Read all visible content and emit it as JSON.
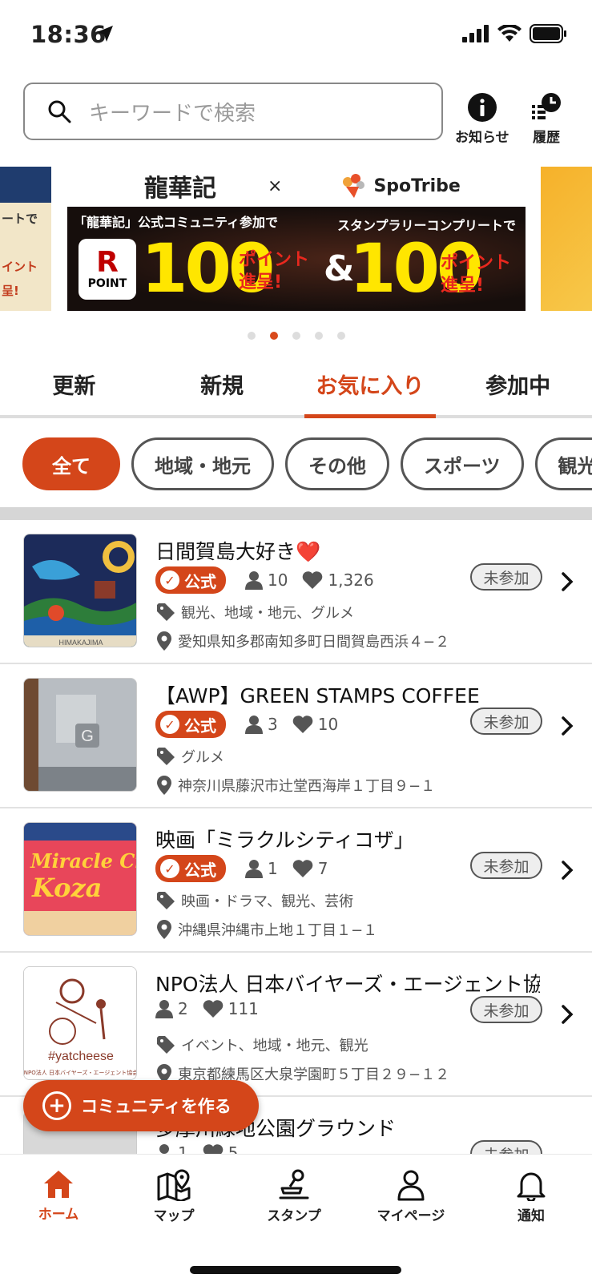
{
  "status_bar": {
    "time": "18:36"
  },
  "search": {
    "placeholder": "キーワードで検索"
  },
  "header_buttons": {
    "notice": "お知らせ",
    "history": "履歴"
  },
  "banner": {
    "logo_left": "龍華記",
    "logo_separator": "×",
    "logo_right": "SpoTribe",
    "text_left": "「龍華記」公式コミュニティ参加で",
    "text_right": "スタンプラリーコンプリートで",
    "rpoint_r": "R",
    "rpoint_label": "POINT",
    "amount_1": "100",
    "amount_2": "100",
    "points_text": "ポイント",
    "gift_text": "進呈!",
    "ampersand": "&",
    "prev_banner_text_1": "ートで",
    "prev_banner_text_2": "イント",
    "prev_banner_text_3": "呈!",
    "dots_count": 5,
    "active_dot": 1
  },
  "tabs": [
    {
      "label": "更新",
      "active": false
    },
    {
      "label": "新規",
      "active": false
    },
    {
      "label": "お気に入り",
      "active": true
    },
    {
      "label": "参加中",
      "active": false
    }
  ],
  "chips": [
    {
      "label": "全て",
      "active": true
    },
    {
      "label": "地域・地元",
      "active": false
    },
    {
      "label": "その他",
      "active": false
    },
    {
      "label": "スポーツ",
      "active": false
    },
    {
      "label": "観光",
      "active": false
    }
  ],
  "communities": [
    {
      "title": "日間賀島大好き❤️",
      "official": true,
      "official_label": "公式",
      "members": "10",
      "likes": "1,326",
      "tags": "観光、地域・地元、グルメ",
      "address": "愛知県知多郡南知多町日間賀島西浜４−２",
      "status": "未参加"
    },
    {
      "title": "【AWP】GREEN STAMPS COFFEE",
      "official": true,
      "official_label": "公式",
      "members": "3",
      "likes": "10",
      "tags": "グルメ",
      "address": "神奈川県藤沢市辻堂西海岸１丁目９−１",
      "status": "未参加"
    },
    {
      "title": "映画「ミラクルシティコザ」",
      "official": true,
      "official_label": "公式",
      "members": "1",
      "likes": "7",
      "tags": "映画・ドラマ、観光、芸術",
      "address": "沖縄県沖縄市上地１丁目１−１",
      "status": "未参加"
    },
    {
      "title": "NPO法人 日本バイヤーズ・エージェント協",
      "official": false,
      "official_label": "",
      "members": "2",
      "likes": "111",
      "tags": "イベント、地域・地元、観光",
      "address": "東京都練馬区大泉学園町５丁目２９−１２",
      "status": "未参加"
    },
    {
      "title": "多摩川緑地公園グラウンド",
      "official": false,
      "official_label": "",
      "members": "1",
      "likes": "5",
      "tags": "",
      "address": "",
      "status": "未参加"
    }
  ],
  "thumb_texts": {
    "thumb1_caption": "HIMAKAJIMA",
    "thumb3_line1": "Miracle City",
    "thumb3_line2": "Koza",
    "thumb4_tag": "#yatcheese",
    "thumb4_caption": "NPO法人 日本バイヤーズ・エージェント協会"
  },
  "fab": {
    "label": "コミュニティを作る"
  },
  "bottom_nav": [
    {
      "label": "ホーム",
      "icon": "home-icon",
      "active": true
    },
    {
      "label": "マップ",
      "icon": "map-icon",
      "active": false
    },
    {
      "label": "スタンプ",
      "icon": "stamp-icon",
      "active": false
    },
    {
      "label": "マイページ",
      "icon": "person-icon",
      "active": false
    },
    {
      "label": "通知",
      "icon": "bell-icon",
      "active": false
    }
  ],
  "colors": {
    "accent": "#d4461a",
    "text": "#222222",
    "muted": "#555555"
  }
}
